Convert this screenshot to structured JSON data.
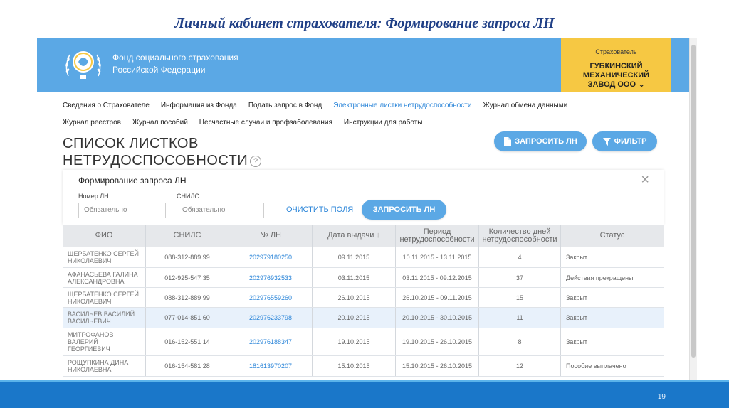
{
  "slide": {
    "title": "Личный кабинет страхователя: Формирование запроса ЛН",
    "page_number": "19"
  },
  "header": {
    "org_line1": "Фонд социального страхования",
    "org_line2": "Российской Федерации",
    "insurer_caption": "Страхователь",
    "insurer_name_lines": [
      "ГУБКИНСКИЙ",
      "МЕХАНИЧЕСКИЙ",
      "ЗАВОД ООО"
    ],
    "logo_icon": "fss-emblem-icon"
  },
  "nav": {
    "row1": [
      "Сведения о Страхователе",
      "Информация из Фонда",
      "Подать запрос в Фонд",
      "Электронные листки нетрудоспособности",
      "Журнал обмена данными"
    ],
    "row2": [
      "Журнал реестров",
      "Журнал пособий",
      "Несчастные случаи и профзаболевания",
      "Инструкции для работы"
    ],
    "active": "Электронные листки нетрудоспособности"
  },
  "page": {
    "title_line1": "СПИСОК ЛИСТКОВ",
    "title_line2": "НЕТРУДОСПОСОБНОСТИ",
    "help_symbol": "?",
    "request_button": "ЗАПРОСИТЬ ЛН",
    "filter_button": "ФИЛЬТР"
  },
  "form": {
    "title": "Формирование запроса ЛН",
    "ln_label": "Номер ЛН",
    "ln_placeholder": "Обязательно",
    "snils_label": "СНИЛС",
    "snils_placeholder": "Обязательно",
    "clear_label": "ОЧИСТИТЬ ПОЛЯ",
    "submit_label": "ЗАПРОСИТЬ ЛН",
    "close_symbol": "×"
  },
  "table": {
    "headers": [
      "ФИО",
      "СНИЛС",
      "№ ЛН",
      "Дата выдачи",
      "Период нетрудоспособности",
      "Количество дней нетрудоспособности",
      "Статус"
    ],
    "sort_symbol": "↓",
    "rows": [
      {
        "fio": "ЩЕРБАТЕНКО СЕРГЕЙ НИКОЛАЕВИЧ",
        "snils": "088-312-889 99",
        "ln": "202979180250",
        "date": "09.11.2015",
        "period": "10.11.2015 - 13.11.2015",
        "days": "4",
        "status": "Закрыт"
      },
      {
        "fio": "АФАНАСЬЕВА ГАЛИНА АЛЕКСАНДРОВНА",
        "snils": "012-925-547 35",
        "ln": "202976932533",
        "date": "03.11.2015",
        "period": "03.11.2015 - 09.12.2015",
        "days": "37",
        "status": "Действия прекращены"
      },
      {
        "fio": "ЩЕРБАТЕНКО СЕРГЕЙ НИКОЛАЕВИЧ",
        "snils": "088-312-889 99",
        "ln": "202976559260",
        "date": "26.10.2015",
        "period": "26.10.2015 - 09.11.2015",
        "days": "15",
        "status": "Закрыт"
      },
      {
        "fio": "ВАСИЛЬЕВ ВАСИЛИЙ ВАСИЛЬЕВИЧ",
        "snils": "077-014-851 60",
        "ln": "202976233798",
        "date": "20.10.2015",
        "period": "20.10.2015 - 30.10.2015",
        "days": "11",
        "status": "Закрыт"
      },
      {
        "fio": "МИТРОФАНОВ ВАЛЕРИЙ ГЕОРГИЕВИЧ",
        "snils": "016-152-551 14",
        "ln": "202976188347",
        "date": "19.10.2015",
        "period": "19.10.2015 - 26.10.2015",
        "days": "8",
        "status": "Закрыт"
      },
      {
        "fio": "РОЩУПКИНА ДИНА НИКОЛАЕВНА",
        "snils": "016-154-581 28",
        "ln": "181613970207",
        "date": "15.10.2015",
        "period": "15.10.2015 - 26.10.2015",
        "days": "12",
        "status": "Пособие выплачено"
      }
    ]
  },
  "colors": {
    "header_blue": "#5ba8e5",
    "insurer_yellow": "#f6c843",
    "link_blue": "#2c86d9",
    "title_navy": "#1f3f86",
    "footer_blue": "#1a77c9"
  }
}
